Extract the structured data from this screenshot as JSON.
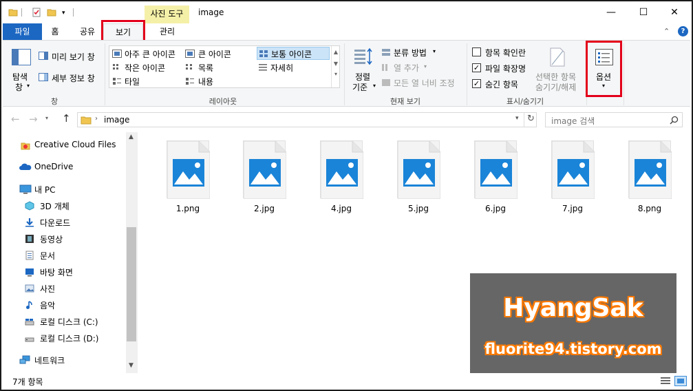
{
  "window": {
    "title": "image",
    "context_tab": "사진 도구",
    "minimize": "—",
    "maximize": "☐",
    "close": "✕"
  },
  "ribbon_tabs": {
    "file": "파일",
    "home": "홈",
    "share": "공유",
    "view": "보기",
    "manage": "관리"
  },
  "ribbon": {
    "pane": {
      "nav_pane_line1": "탐색",
      "nav_pane_line2": "창",
      "preview_pane": "미리 보기 창",
      "details_pane": "세부 정보 창",
      "group_label": "창"
    },
    "layout": {
      "extra_large_icons": "아주 큰 아이콘",
      "large_icons": "큰 아이콘",
      "medium_icons": "보통 아이콘",
      "small_icons": "작은 아이콘",
      "list": "목록",
      "details": "자세히",
      "tiles": "타일",
      "content": "내용",
      "group_label": "레이아웃"
    },
    "current_view": {
      "sort_line1": "정렬",
      "sort_line2": "기준",
      "group_by": "분류 방법",
      "add_columns": "열 추가",
      "size_all_columns": "모든 열 너비 조정",
      "group_label": "현재 보기"
    },
    "show_hide": {
      "item_check_boxes": "항목 확인란",
      "file_name_extensions": "파일 확장명",
      "hidden_items": "숨긴 항목",
      "hide_selected_line1": "선택한 항목",
      "hide_selected_line2": "숨기기/해제",
      "group_label": "표시/숨기기",
      "item_check_boxes_checked": false,
      "file_name_extensions_checked": true,
      "hidden_items_checked": true
    },
    "options": {
      "label": "옵션"
    }
  },
  "address": {
    "path": "image",
    "search_placeholder": "image 검색"
  },
  "sidebar": {
    "items": [
      {
        "label": "Creative Cloud Files",
        "icon": "creative-cloud-icon"
      },
      {
        "label": "OneDrive",
        "icon": "onedrive-icon"
      },
      {
        "label": "내 PC",
        "icon": "pc-icon"
      },
      {
        "label": "3D 개체",
        "icon": "3d-objects-icon"
      },
      {
        "label": "다운로드",
        "icon": "download-icon"
      },
      {
        "label": "동영상",
        "icon": "video-icon"
      },
      {
        "label": "문서",
        "icon": "documents-icon"
      },
      {
        "label": "바탕 화면",
        "icon": "desktop-icon"
      },
      {
        "label": "사진",
        "icon": "pictures-icon"
      },
      {
        "label": "음악",
        "icon": "music-icon"
      },
      {
        "label": "로컬 디스크 (C:)",
        "icon": "drive-c-icon"
      },
      {
        "label": "로컬 디스크 (D:)",
        "icon": "drive-d-icon"
      },
      {
        "label": "네트워크",
        "icon": "network-icon"
      }
    ]
  },
  "files": [
    {
      "name": "1.png"
    },
    {
      "name": "2.jpg"
    },
    {
      "name": "4.jpg"
    },
    {
      "name": "5.jpg"
    },
    {
      "name": "6.jpg"
    },
    {
      "name": "7.jpg"
    },
    {
      "name": "8.png"
    }
  ],
  "status": {
    "item_count": "7개 항목"
  },
  "watermark": {
    "line1": "HyangSak",
    "line2": "fluorite94.tistory.com"
  },
  "colors": {
    "accent": "#1c67c2",
    "highlight_box": "#e3001b",
    "context_tab": "#f5f0a8",
    "image_icon_blue": "#1a84d8"
  }
}
